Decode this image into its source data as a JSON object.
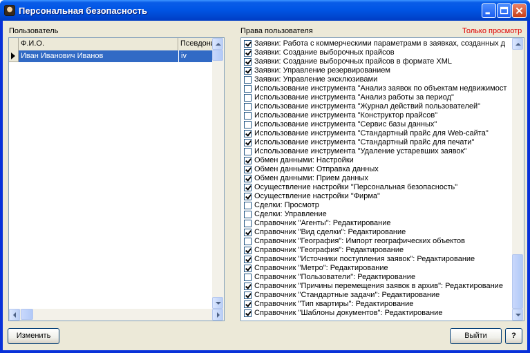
{
  "window": {
    "title": "Персональная безопасность"
  },
  "labels": {
    "user": "Пользователь",
    "rights": "Права пользователя",
    "readonly": "Только просмотр"
  },
  "users_grid": {
    "columns": [
      "Ф.И.О.",
      "Псевдоним"
    ],
    "rows": [
      {
        "name": "Иван Иванович Иванов",
        "alias": "iv",
        "selected": true
      }
    ]
  },
  "rights": [
    {
      "label": "Заявки: Работа с коммерческими параметрами в заявках, созданных д",
      "checked": true
    },
    {
      "label": "Заявки: Создание выборочных прайсов",
      "checked": true
    },
    {
      "label": "Заявки: Создание выборочных прайсов в формате XML",
      "checked": true
    },
    {
      "label": "Заявки: Управление резервированием",
      "checked": true
    },
    {
      "label": "Заявки: Управление эксклюзивами",
      "checked": false
    },
    {
      "label": "Использование инструмента \"Анализ заявок по объектам недвижимост",
      "checked": false
    },
    {
      "label": "Использование инструмента \"Анализ работы за период\"",
      "checked": false
    },
    {
      "label": "Использование инструмента \"Журнал действий пользователей\"",
      "checked": false
    },
    {
      "label": "Использование инструмента \"Конструктор прайсов\"",
      "checked": false
    },
    {
      "label": "Использование инструмента \"Сервис базы данных\"",
      "checked": false
    },
    {
      "label": "Использование инструмента \"Стандартный прайс для Web-сайта\"",
      "checked": true
    },
    {
      "label": "Использование инструмента \"Стандартный прайс для печати\"",
      "checked": true
    },
    {
      "label": "Использование инструмента \"Удаление устаревших заявок\"",
      "checked": false
    },
    {
      "label": "Обмен данными: Настройки",
      "checked": true
    },
    {
      "label": "Обмен данными: Отправка данных",
      "checked": true
    },
    {
      "label": "Обмен данными: Прием данных",
      "checked": true
    },
    {
      "label": "Осуществление настройки \"Персональная безопасность\"",
      "checked": true
    },
    {
      "label": "Осуществление настройки \"Фирма\"",
      "checked": true
    },
    {
      "label": "Сделки: Просмотр",
      "checked": false
    },
    {
      "label": "Сделки: Управление",
      "checked": false
    },
    {
      "label": "Справочник \"Агенты\": Редактирование",
      "checked": false
    },
    {
      "label": "Справочник \"Вид сделки\": Редактирование",
      "checked": true
    },
    {
      "label": "Справочник \"География\": Импорт географических объектов",
      "checked": false
    },
    {
      "label": "Справочник \"География\": Редактирование",
      "checked": true
    },
    {
      "label": "Справочник \"Источники поступления заявок\": Редактирование",
      "checked": true
    },
    {
      "label": "Справочник \"Метро\": Редактирование",
      "checked": true
    },
    {
      "label": "Справочник \"Пользователи\": Редактирование",
      "checked": false
    },
    {
      "label": "Справочник \"Причины перемещения заявок в архив\": Редактирование",
      "checked": true
    },
    {
      "label": "Справочник \"Стандартные задачи\": Редактирование",
      "checked": true
    },
    {
      "label": "Справочник \"Тип квартиры\": Редактирование",
      "checked": true
    },
    {
      "label": "Справочник \"Шаблоны документов\": Редактирование",
      "checked": true
    }
  ],
  "buttons": {
    "change": "Изменить",
    "exit": "Выйти",
    "help": "?"
  }
}
